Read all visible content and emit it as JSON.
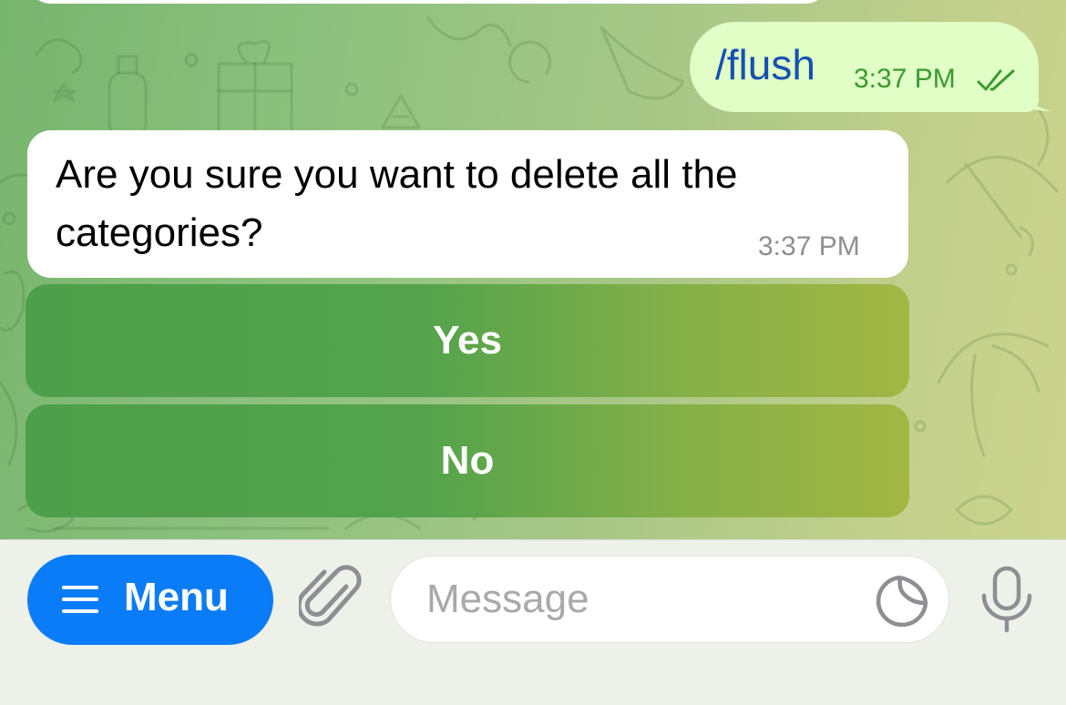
{
  "messages": {
    "outgoing": {
      "text": "/flush",
      "time": "3:37 PM",
      "status_icon": "double-check-read-icon"
    },
    "incoming": {
      "text": "Are you sure you want to delete all the categories?",
      "time": "3:37 PM"
    }
  },
  "inline_keyboard": {
    "buttons": [
      {
        "label": "Yes"
      },
      {
        "label": "No"
      }
    ]
  },
  "input_bar": {
    "menu_icon": "hamburger-icon",
    "menu_label": "Menu",
    "attach_icon": "paperclip-icon",
    "placeholder": "Message",
    "sticker_icon": "sticker-icon",
    "mic_icon": "microphone-icon"
  },
  "colors": {
    "accent": "#0A7CF7",
    "outgoing_bubble": "#E1FEC6",
    "link": "#1650B2",
    "keyboard_button_start": "#4E9F4B",
    "keyboard_button_end": "#A3B643"
  }
}
